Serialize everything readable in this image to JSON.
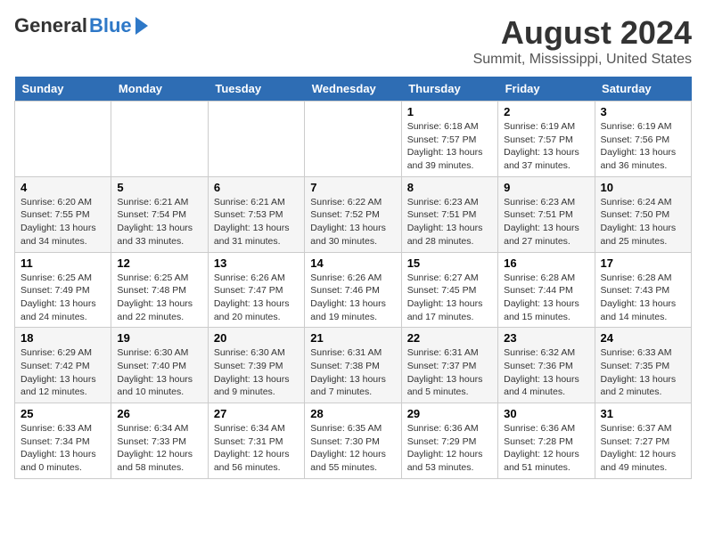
{
  "header": {
    "logo_general": "General",
    "logo_blue": "Blue",
    "title": "August 2024",
    "subtitle": "Summit, Mississippi, United States"
  },
  "weekdays": [
    "Sunday",
    "Monday",
    "Tuesday",
    "Wednesday",
    "Thursday",
    "Friday",
    "Saturday"
  ],
  "weeks": [
    [
      {
        "day": "",
        "info": ""
      },
      {
        "day": "",
        "info": ""
      },
      {
        "day": "",
        "info": ""
      },
      {
        "day": "",
        "info": ""
      },
      {
        "day": "1",
        "info": "Sunrise: 6:18 AM\nSunset: 7:57 PM\nDaylight: 13 hours\nand 39 minutes."
      },
      {
        "day": "2",
        "info": "Sunrise: 6:19 AM\nSunset: 7:57 PM\nDaylight: 13 hours\nand 37 minutes."
      },
      {
        "day": "3",
        "info": "Sunrise: 6:19 AM\nSunset: 7:56 PM\nDaylight: 13 hours\nand 36 minutes."
      }
    ],
    [
      {
        "day": "4",
        "info": "Sunrise: 6:20 AM\nSunset: 7:55 PM\nDaylight: 13 hours\nand 34 minutes."
      },
      {
        "day": "5",
        "info": "Sunrise: 6:21 AM\nSunset: 7:54 PM\nDaylight: 13 hours\nand 33 minutes."
      },
      {
        "day": "6",
        "info": "Sunrise: 6:21 AM\nSunset: 7:53 PM\nDaylight: 13 hours\nand 31 minutes."
      },
      {
        "day": "7",
        "info": "Sunrise: 6:22 AM\nSunset: 7:52 PM\nDaylight: 13 hours\nand 30 minutes."
      },
      {
        "day": "8",
        "info": "Sunrise: 6:23 AM\nSunset: 7:51 PM\nDaylight: 13 hours\nand 28 minutes."
      },
      {
        "day": "9",
        "info": "Sunrise: 6:23 AM\nSunset: 7:51 PM\nDaylight: 13 hours\nand 27 minutes."
      },
      {
        "day": "10",
        "info": "Sunrise: 6:24 AM\nSunset: 7:50 PM\nDaylight: 13 hours\nand 25 minutes."
      }
    ],
    [
      {
        "day": "11",
        "info": "Sunrise: 6:25 AM\nSunset: 7:49 PM\nDaylight: 13 hours\nand 24 minutes."
      },
      {
        "day": "12",
        "info": "Sunrise: 6:25 AM\nSunset: 7:48 PM\nDaylight: 13 hours\nand 22 minutes."
      },
      {
        "day": "13",
        "info": "Sunrise: 6:26 AM\nSunset: 7:47 PM\nDaylight: 13 hours\nand 20 minutes."
      },
      {
        "day": "14",
        "info": "Sunrise: 6:26 AM\nSunset: 7:46 PM\nDaylight: 13 hours\nand 19 minutes."
      },
      {
        "day": "15",
        "info": "Sunrise: 6:27 AM\nSunset: 7:45 PM\nDaylight: 13 hours\nand 17 minutes."
      },
      {
        "day": "16",
        "info": "Sunrise: 6:28 AM\nSunset: 7:44 PM\nDaylight: 13 hours\nand 15 minutes."
      },
      {
        "day": "17",
        "info": "Sunrise: 6:28 AM\nSunset: 7:43 PM\nDaylight: 13 hours\nand 14 minutes."
      }
    ],
    [
      {
        "day": "18",
        "info": "Sunrise: 6:29 AM\nSunset: 7:42 PM\nDaylight: 13 hours\nand 12 minutes."
      },
      {
        "day": "19",
        "info": "Sunrise: 6:30 AM\nSunset: 7:40 PM\nDaylight: 13 hours\nand 10 minutes."
      },
      {
        "day": "20",
        "info": "Sunrise: 6:30 AM\nSunset: 7:39 PM\nDaylight: 13 hours\nand 9 minutes."
      },
      {
        "day": "21",
        "info": "Sunrise: 6:31 AM\nSunset: 7:38 PM\nDaylight: 13 hours\nand 7 minutes."
      },
      {
        "day": "22",
        "info": "Sunrise: 6:31 AM\nSunset: 7:37 PM\nDaylight: 13 hours\nand 5 minutes."
      },
      {
        "day": "23",
        "info": "Sunrise: 6:32 AM\nSunset: 7:36 PM\nDaylight: 13 hours\nand 4 minutes."
      },
      {
        "day": "24",
        "info": "Sunrise: 6:33 AM\nSunset: 7:35 PM\nDaylight: 13 hours\nand 2 minutes."
      }
    ],
    [
      {
        "day": "25",
        "info": "Sunrise: 6:33 AM\nSunset: 7:34 PM\nDaylight: 13 hours\nand 0 minutes."
      },
      {
        "day": "26",
        "info": "Sunrise: 6:34 AM\nSunset: 7:33 PM\nDaylight: 12 hours\nand 58 minutes."
      },
      {
        "day": "27",
        "info": "Sunrise: 6:34 AM\nSunset: 7:31 PM\nDaylight: 12 hours\nand 56 minutes."
      },
      {
        "day": "28",
        "info": "Sunrise: 6:35 AM\nSunset: 7:30 PM\nDaylight: 12 hours\nand 55 minutes."
      },
      {
        "day": "29",
        "info": "Sunrise: 6:36 AM\nSunset: 7:29 PM\nDaylight: 12 hours\nand 53 minutes."
      },
      {
        "day": "30",
        "info": "Sunrise: 6:36 AM\nSunset: 7:28 PM\nDaylight: 12 hours\nand 51 minutes."
      },
      {
        "day": "31",
        "info": "Sunrise: 6:37 AM\nSunset: 7:27 PM\nDaylight: 12 hours\nand 49 minutes."
      }
    ]
  ]
}
